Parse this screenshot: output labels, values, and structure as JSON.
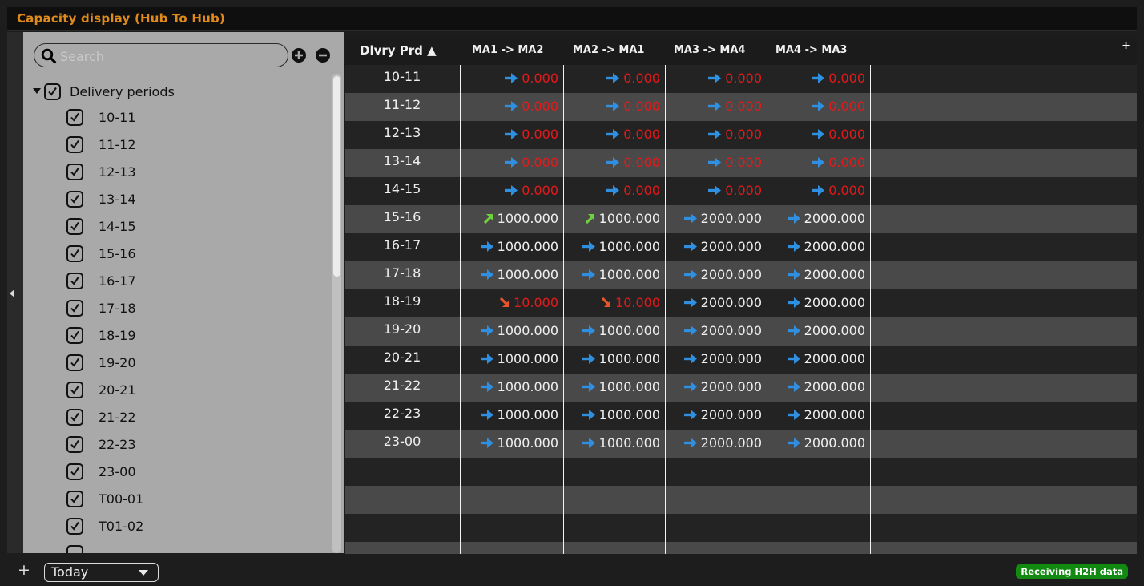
{
  "window": {
    "title": "Capacity display (Hub To Hub)"
  },
  "sidebar": {
    "search_placeholder": "Search",
    "tree_root_label": "Delivery periods",
    "items": [
      "10-11",
      "11-12",
      "12-13",
      "13-14",
      "14-15",
      "15-16",
      "16-17",
      "17-18",
      "18-19",
      "19-20",
      "20-21",
      "21-22",
      "22-23",
      "23-00",
      "T00-01",
      "T01-02"
    ]
  },
  "grid": {
    "period_header": "Dlvry Prd",
    "sort_indicator": "▲",
    "add_column_icon": "+",
    "columns": [
      "MA1 -> MA2",
      "MA2 -> MA1",
      "MA3 -> MA4",
      "MA4 -> MA3"
    ],
    "rows": [
      {
        "period": "10-11",
        "cells": [
          {
            "v": "0.000",
            "d": "flat"
          },
          {
            "v": "0.000",
            "d": "flat"
          },
          {
            "v": "0.000",
            "d": "flat"
          },
          {
            "v": "0.000",
            "d": "flat"
          }
        ]
      },
      {
        "period": "11-12",
        "cells": [
          {
            "v": "0.000",
            "d": "flat"
          },
          {
            "v": "0.000",
            "d": "flat"
          },
          {
            "v": "0.000",
            "d": "flat"
          },
          {
            "v": "0.000",
            "d": "flat"
          }
        ]
      },
      {
        "period": "12-13",
        "cells": [
          {
            "v": "0.000",
            "d": "flat"
          },
          {
            "v": "0.000",
            "d": "flat"
          },
          {
            "v": "0.000",
            "d": "flat"
          },
          {
            "v": "0.000",
            "d": "flat"
          }
        ]
      },
      {
        "period": "13-14",
        "cells": [
          {
            "v": "0.000",
            "d": "flat"
          },
          {
            "v": "0.000",
            "d": "flat"
          },
          {
            "v": "0.000",
            "d": "flat"
          },
          {
            "v": "0.000",
            "d": "flat"
          }
        ]
      },
      {
        "period": "14-15",
        "cells": [
          {
            "v": "0.000",
            "d": "flat"
          },
          {
            "v": "0.000",
            "d": "flat"
          },
          {
            "v": "0.000",
            "d": "flat"
          },
          {
            "v": "0.000",
            "d": "flat"
          }
        ]
      },
      {
        "period": "15-16",
        "cells": [
          {
            "v": "1000.000",
            "d": "up"
          },
          {
            "v": "1000.000",
            "d": "up"
          },
          {
            "v": "2000.000",
            "d": "flat"
          },
          {
            "v": "2000.000",
            "d": "flat"
          }
        ]
      },
      {
        "period": "16-17",
        "cells": [
          {
            "v": "1000.000",
            "d": "flat"
          },
          {
            "v": "1000.000",
            "d": "flat"
          },
          {
            "v": "2000.000",
            "d": "flat"
          },
          {
            "v": "2000.000",
            "d": "flat"
          }
        ]
      },
      {
        "period": "17-18",
        "cells": [
          {
            "v": "1000.000",
            "d": "flat"
          },
          {
            "v": "1000.000",
            "d": "flat"
          },
          {
            "v": "2000.000",
            "d": "flat"
          },
          {
            "v": "2000.000",
            "d": "flat"
          }
        ]
      },
      {
        "period": "18-19",
        "cells": [
          {
            "v": "10.000",
            "d": "down"
          },
          {
            "v": "10.000",
            "d": "down"
          },
          {
            "v": "2000.000",
            "d": "flat"
          },
          {
            "v": "2000.000",
            "d": "flat"
          }
        ]
      },
      {
        "period": "19-20",
        "cells": [
          {
            "v": "1000.000",
            "d": "flat"
          },
          {
            "v": "1000.000",
            "d": "flat"
          },
          {
            "v": "2000.000",
            "d": "flat"
          },
          {
            "v": "2000.000",
            "d": "flat"
          }
        ]
      },
      {
        "period": "20-21",
        "cells": [
          {
            "v": "1000.000",
            "d": "flat"
          },
          {
            "v": "1000.000",
            "d": "flat"
          },
          {
            "v": "2000.000",
            "d": "flat"
          },
          {
            "v": "2000.000",
            "d": "flat"
          }
        ]
      },
      {
        "period": "21-22",
        "cells": [
          {
            "v": "1000.000",
            "d": "flat"
          },
          {
            "v": "1000.000",
            "d": "flat"
          },
          {
            "v": "2000.000",
            "d": "flat"
          },
          {
            "v": "2000.000",
            "d": "flat"
          }
        ]
      },
      {
        "period": "22-23",
        "cells": [
          {
            "v": "1000.000",
            "d": "flat"
          },
          {
            "v": "1000.000",
            "d": "flat"
          },
          {
            "v": "2000.000",
            "d": "flat"
          },
          {
            "v": "2000.000",
            "d": "flat"
          }
        ]
      },
      {
        "period": "23-00",
        "cells": [
          {
            "v": "1000.000",
            "d": "flat"
          },
          {
            "v": "1000.000",
            "d": "flat"
          },
          {
            "v": "2000.000",
            "d": "flat"
          },
          {
            "v": "2000.000",
            "d": "flat"
          }
        ]
      }
    ]
  },
  "footer": {
    "add_icon": "+",
    "date_selector": "Today",
    "status_badge": "Receiving H2H data"
  },
  "icons": {
    "flat": "arrow-right-icon",
    "up": "arrow-up-right-icon",
    "down": "arrow-down-right-icon"
  },
  "colors": {
    "title": "#e08a1c",
    "red_value": "#e41a1a",
    "normal_value": "#f0f0f0",
    "arrow_blue": "#2f8fe0",
    "arrow_green": "#6ed33a",
    "arrow_orange": "#e8552a",
    "badge_green": "#128a12"
  }
}
